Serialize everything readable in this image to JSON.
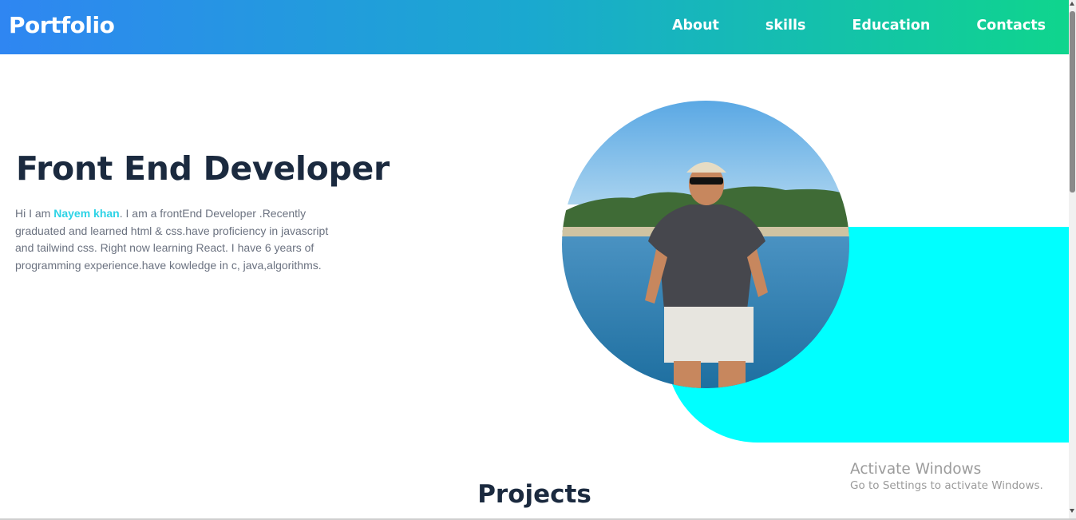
{
  "navbar": {
    "brand": "Portfolio",
    "links": [
      {
        "label": "About"
      },
      {
        "label": "skills"
      },
      {
        "label": "Education"
      },
      {
        "label": "Contacts"
      }
    ]
  },
  "hero": {
    "title": "Front End Developer",
    "intro_prefix": "Hi I am ",
    "name": "Nayem khan",
    "intro_body": ". I am a frontEnd Developer .Recently graduated and learned html & css.have proficiency in javascript and tailwind css. Right now learning React. I have 6 years of programming experience.have kowledge in c, java,algorithms.",
    "photo": "profile-photo",
    "accent_color": "#00ffff",
    "name_color": "#2ed3e6"
  },
  "projects": {
    "title": "Projects"
  },
  "watermark": {
    "title": "Activate Windows",
    "subtitle": "Go to Settings to activate Windows."
  },
  "colors": {
    "nav_gradient_start": "#2f86f2",
    "nav_gradient_end": "#0fd58d",
    "heading": "#1b2a3f"
  }
}
